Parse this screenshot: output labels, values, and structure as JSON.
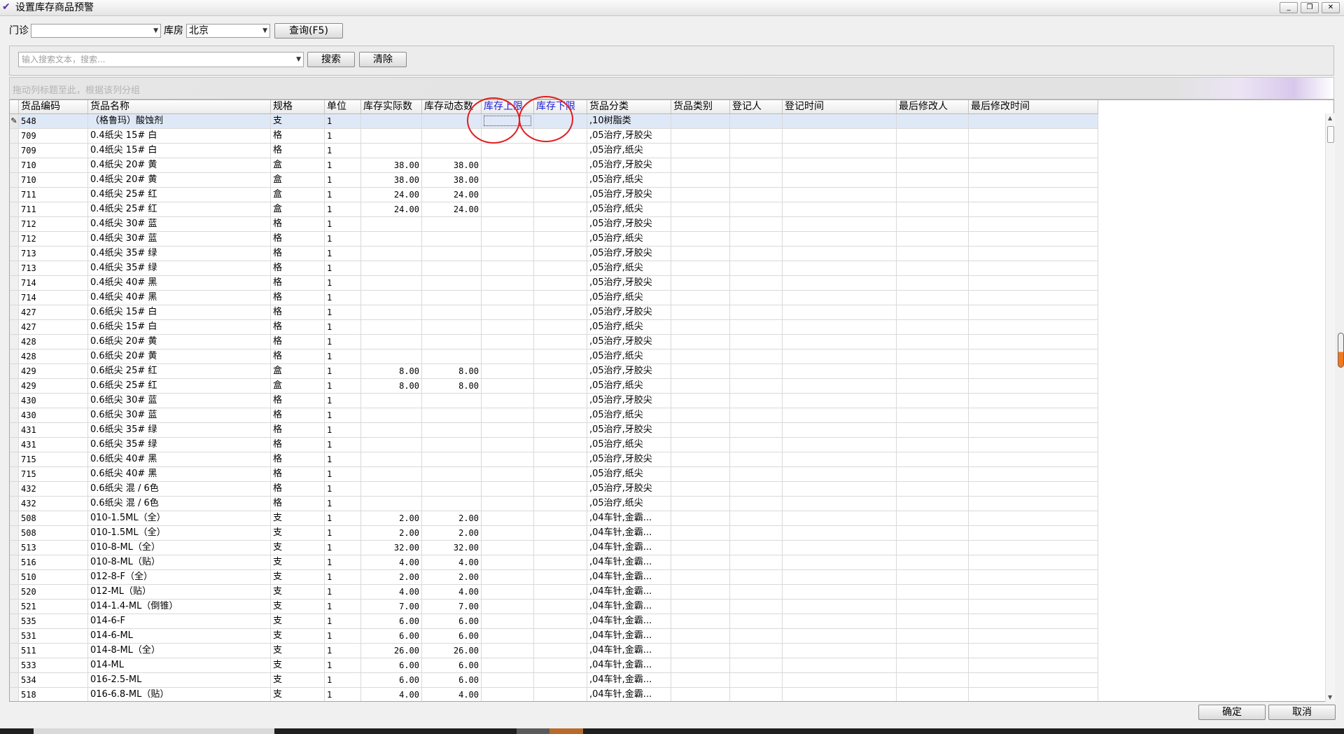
{
  "window": {
    "title": "设置库存商品预警",
    "minimize_label": "_",
    "restore_label": "❐",
    "close_label": "✕"
  },
  "filters": {
    "clinic_label": "门诊",
    "clinic_value": "",
    "warehouse_label": "库房",
    "warehouse_value": "北京",
    "query_button": "查询(F5)"
  },
  "search": {
    "placeholder": "输入搜索文本，搜索...",
    "search_button": "搜索",
    "clear_button": "清除"
  },
  "group_panel_hint": "拖动列标题至此，根据该列分组",
  "grid": {
    "columns": [
      "货品编码",
      "货品名称",
      "规格",
      "单位",
      "库存实际数",
      "库存动态数",
      "库存上限",
      "库存下限",
      "货品分类",
      "货品类别",
      "登记人",
      "登记时间",
      "最后修改人",
      "最后修改时间"
    ],
    "rows": [
      [
        "548",
        "（格鲁玛）酸蚀剂",
        "支",
        "1",
        "",
        "",
        "",
        "",
        ",10树脂类",
        "",
        "",
        "",
        "",
        ""
      ],
      [
        "709",
        "0.4纸尖 15# 白",
        "格",
        "1",
        "",
        "",
        "",
        "",
        ",05治疗,牙胶尖",
        "",
        "",
        "",
        "",
        ""
      ],
      [
        "709",
        "0.4纸尖 15# 白",
        "格",
        "1",
        "",
        "",
        "",
        "",
        ",05治疗,纸尖",
        "",
        "",
        "",
        "",
        ""
      ],
      [
        "710",
        "0.4纸尖 20# 黄",
        "盒",
        "1",
        "38.00",
        "38.00",
        "",
        "",
        ",05治疗,牙胶尖",
        "",
        "",
        "",
        "",
        ""
      ],
      [
        "710",
        "0.4纸尖 20# 黄",
        "盒",
        "1",
        "38.00",
        "38.00",
        "",
        "",
        ",05治疗,纸尖",
        "",
        "",
        "",
        "",
        ""
      ],
      [
        "711",
        "0.4纸尖 25# 红",
        "盒",
        "1",
        "24.00",
        "24.00",
        "",
        "",
        ",05治疗,牙胶尖",
        "",
        "",
        "",
        "",
        ""
      ],
      [
        "711",
        "0.4纸尖 25# 红",
        "盒",
        "1",
        "24.00",
        "24.00",
        "",
        "",
        ",05治疗,纸尖",
        "",
        "",
        "",
        "",
        ""
      ],
      [
        "712",
        "0.4纸尖 30# 蓝",
        "格",
        "1",
        "",
        "",
        "",
        "",
        ",05治疗,牙胶尖",
        "",
        "",
        "",
        "",
        ""
      ],
      [
        "712",
        "0.4纸尖 30# 蓝",
        "格",
        "1",
        "",
        "",
        "",
        "",
        ",05治疗,纸尖",
        "",
        "",
        "",
        "",
        ""
      ],
      [
        "713",
        "0.4纸尖 35# 绿",
        "格",
        "1",
        "",
        "",
        "",
        "",
        ",05治疗,牙胶尖",
        "",
        "",
        "",
        "",
        ""
      ],
      [
        "713",
        "0.4纸尖 35# 绿",
        "格",
        "1",
        "",
        "",
        "",
        "",
        ",05治疗,纸尖",
        "",
        "",
        "",
        "",
        ""
      ],
      [
        "714",
        "0.4纸尖 40# 黑",
        "格",
        "1",
        "",
        "",
        "",
        "",
        ",05治疗,牙胶尖",
        "",
        "",
        "",
        "",
        ""
      ],
      [
        "714",
        "0.4纸尖 40# 黑",
        "格",
        "1",
        "",
        "",
        "",
        "",
        ",05治疗,纸尖",
        "",
        "",
        "",
        "",
        ""
      ],
      [
        "427",
        "0.6纸尖 15# 白",
        "格",
        "1",
        "",
        "",
        "",
        "",
        ",05治疗,牙胶尖",
        "",
        "",
        "",
        "",
        ""
      ],
      [
        "427",
        "0.6纸尖 15# 白",
        "格",
        "1",
        "",
        "",
        "",
        "",
        ",05治疗,纸尖",
        "",
        "",
        "",
        "",
        ""
      ],
      [
        "428",
        "0.6纸尖 20# 黄",
        "格",
        "1",
        "",
        "",
        "",
        "",
        ",05治疗,牙胶尖",
        "",
        "",
        "",
        "",
        ""
      ],
      [
        "428",
        "0.6纸尖 20# 黄",
        "格",
        "1",
        "",
        "",
        "",
        "",
        ",05治疗,纸尖",
        "",
        "",
        "",
        "",
        ""
      ],
      [
        "429",
        "0.6纸尖 25# 红",
        "盒",
        "1",
        "8.00",
        "8.00",
        "",
        "",
        ",05治疗,牙胶尖",
        "",
        "",
        "",
        "",
        ""
      ],
      [
        "429",
        "0.6纸尖 25# 红",
        "盒",
        "1",
        "8.00",
        "8.00",
        "",
        "",
        ",05治疗,纸尖",
        "",
        "",
        "",
        "",
        ""
      ],
      [
        "430",
        "0.6纸尖 30# 蓝",
        "格",
        "1",
        "",
        "",
        "",
        "",
        ",05治疗,牙胶尖",
        "",
        "",
        "",
        "",
        ""
      ],
      [
        "430",
        "0.6纸尖 30# 蓝",
        "格",
        "1",
        "",
        "",
        "",
        "",
        ",05治疗,纸尖",
        "",
        "",
        "",
        "",
        ""
      ],
      [
        "431",
        "0.6纸尖 35# 绿",
        "格",
        "1",
        "",
        "",
        "",
        "",
        ",05治疗,牙胶尖",
        "",
        "",
        "",
        "",
        ""
      ],
      [
        "431",
        "0.6纸尖 35# 绿",
        "格",
        "1",
        "",
        "",
        "",
        "",
        ",05治疗,纸尖",
        "",
        "",
        "",
        "",
        ""
      ],
      [
        "715",
        "0.6纸尖 40# 黑",
        "格",
        "1",
        "",
        "",
        "",
        "",
        ",05治疗,牙胶尖",
        "",
        "",
        "",
        "",
        ""
      ],
      [
        "715",
        "0.6纸尖 40# 黑",
        "格",
        "1",
        "",
        "",
        "",
        "",
        ",05治疗,纸尖",
        "",
        "",
        "",
        "",
        ""
      ],
      [
        "432",
        "0.6纸尖 混 / 6色",
        "格",
        "1",
        "",
        "",
        "",
        "",
        ",05治疗,牙胶尖",
        "",
        "",
        "",
        "",
        ""
      ],
      [
        "432",
        "0.6纸尖 混 / 6色",
        "格",
        "1",
        "",
        "",
        "",
        "",
        ",05治疗,纸尖",
        "",
        "",
        "",
        "",
        ""
      ],
      [
        "508",
        "010-1.5ML（全）",
        "支",
        "1",
        "2.00",
        "2.00",
        "",
        "",
        ",04车针,金霸...",
        "",
        "",
        "",
        "",
        ""
      ],
      [
        "508",
        "010-1.5ML（全）",
        "支",
        "1",
        "2.00",
        "2.00",
        "",
        "",
        ",04车针,金霸...",
        "",
        "",
        "",
        "",
        ""
      ],
      [
        "513",
        "010-8-ML（全）",
        "支",
        "1",
        "32.00",
        "32.00",
        "",
        "",
        ",04车针,金霸...",
        "",
        "",
        "",
        "",
        ""
      ],
      [
        "516",
        "010-8-ML（贴）",
        "支",
        "1",
        "4.00",
        "4.00",
        "",
        "",
        ",04车针,金霸...",
        "",
        "",
        "",
        "",
        ""
      ],
      [
        "510",
        "012-8-F（全）",
        "支",
        "1",
        "2.00",
        "2.00",
        "",
        "",
        ",04车针,金霸...",
        "",
        "",
        "",
        "",
        ""
      ],
      [
        "520",
        "012-ML（贴）",
        "支",
        "1",
        "4.00",
        "4.00",
        "",
        "",
        ",04车针,金霸...",
        "",
        "",
        "",
        "",
        ""
      ],
      [
        "521",
        "014-1.4-ML（倒锥）",
        "支",
        "1",
        "7.00",
        "7.00",
        "",
        "",
        ",04车针,金霸...",
        "",
        "",
        "",
        "",
        ""
      ],
      [
        "535",
        "014-6-F",
        "支",
        "1",
        "6.00",
        "6.00",
        "",
        "",
        ",04车针,金霸...",
        "",
        "",
        "",
        "",
        ""
      ],
      [
        "531",
        "014-6-ML",
        "支",
        "1",
        "6.00",
        "6.00",
        "",
        "",
        ",04车针,金霸...",
        "",
        "",
        "",
        "",
        ""
      ],
      [
        "511",
        "014-8-ML（全）",
        "支",
        "1",
        "26.00",
        "26.00",
        "",
        "",
        ",04车针,金霸...",
        "",
        "",
        "",
        "",
        ""
      ],
      [
        "533",
        "014-ML",
        "支",
        "1",
        "6.00",
        "6.00",
        "",
        "",
        ",04车针,金霸...",
        "",
        "",
        "",
        "",
        ""
      ],
      [
        "534",
        "016-2.5-ML",
        "支",
        "1",
        "6.00",
        "6.00",
        "",
        "",
        ",04车针,金霸...",
        "",
        "",
        "",
        "",
        ""
      ],
      [
        "518",
        "016-6.8-ML（贴）",
        "支",
        "1",
        "4.00",
        "4.00",
        "",
        "",
        ",04车针,金霸...",
        "",
        "",
        "",
        "",
        ""
      ]
    ],
    "selected_row_indicator": "✎",
    "highlight_color": "#1c1cd6",
    "annotation_color": "#e02020"
  },
  "footer": {
    "ok_button": "确定",
    "cancel_button": "取消"
  }
}
